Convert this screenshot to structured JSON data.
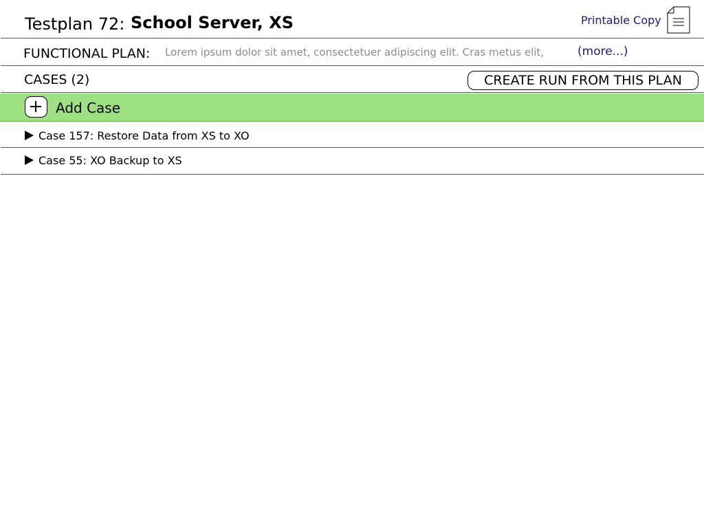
{
  "header": {
    "title_prefix": "Testplan 72:",
    "title_name": "School Server, XS",
    "printable_link": "Printable Copy",
    "printable_icon": "document-icon"
  },
  "functional_plan": {
    "label": "FUNCTIONAL PLAN:",
    "text": "Lorem ipsum dolor sit amet, consectetuer adipiscing elit. Cras metus elit,",
    "more_link": "(more...)"
  },
  "cases": {
    "label": "CASES (2)",
    "create_run_button": "CREATE RUN FROM THIS PLAN",
    "add_case": {
      "icon": "plus-icon",
      "label": "Add Case",
      "background": "#9de182"
    },
    "items": [
      {
        "icon": "expand-triangle-icon",
        "label": "Case 157: Restore Data from XS to XO"
      },
      {
        "icon": "expand-triangle-icon",
        "label": "Case 55: XO Backup to XS"
      }
    ]
  },
  "colors": {
    "link": "#1a1a80",
    "muted_text": "#8a8a8a",
    "add_bar": "#9de182"
  }
}
